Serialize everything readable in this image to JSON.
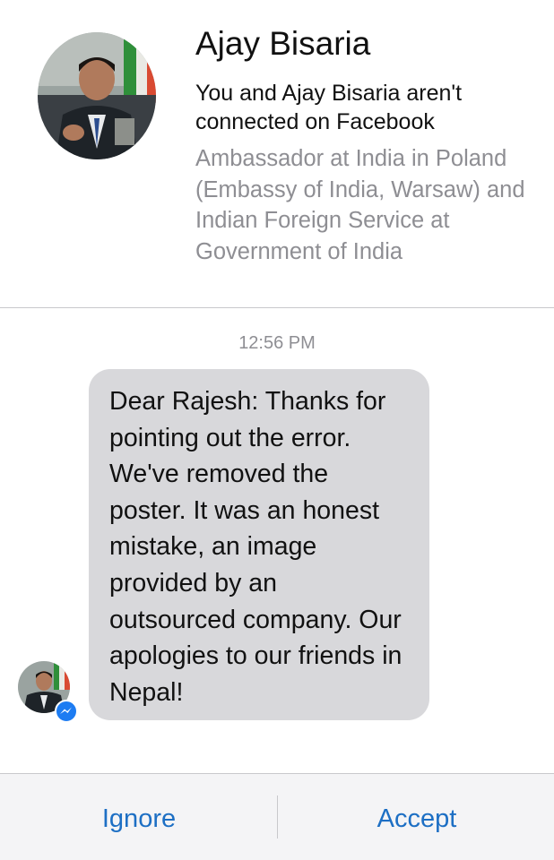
{
  "profile": {
    "name": "Ajay Bisaria",
    "connection_status": "You and Ajay Bisaria aren't connected on Facebook",
    "work": "Ambassador at India in Poland (Embassy of India, Warsaw) and Indian Foreign Service at Government of India",
    "avatar_icon": "profile-photo"
  },
  "conversation": {
    "timestamp": "12:56 PM",
    "message": "Dear Rajesh: Thanks for pointing out the error. We've removed the poster. It was an honest mistake, an image provided by an outsourced company. Our apologies to our friends in Nepal!",
    "badge_icon": "messenger-icon"
  },
  "actions": {
    "ignore_label": "Ignore",
    "accept_label": "Accept"
  },
  "colors": {
    "accent": "#1d6fc4",
    "bubble": "#d8d8db",
    "secondary_text": "#8e8e93",
    "messenger_blue": "#1d7cf2"
  }
}
